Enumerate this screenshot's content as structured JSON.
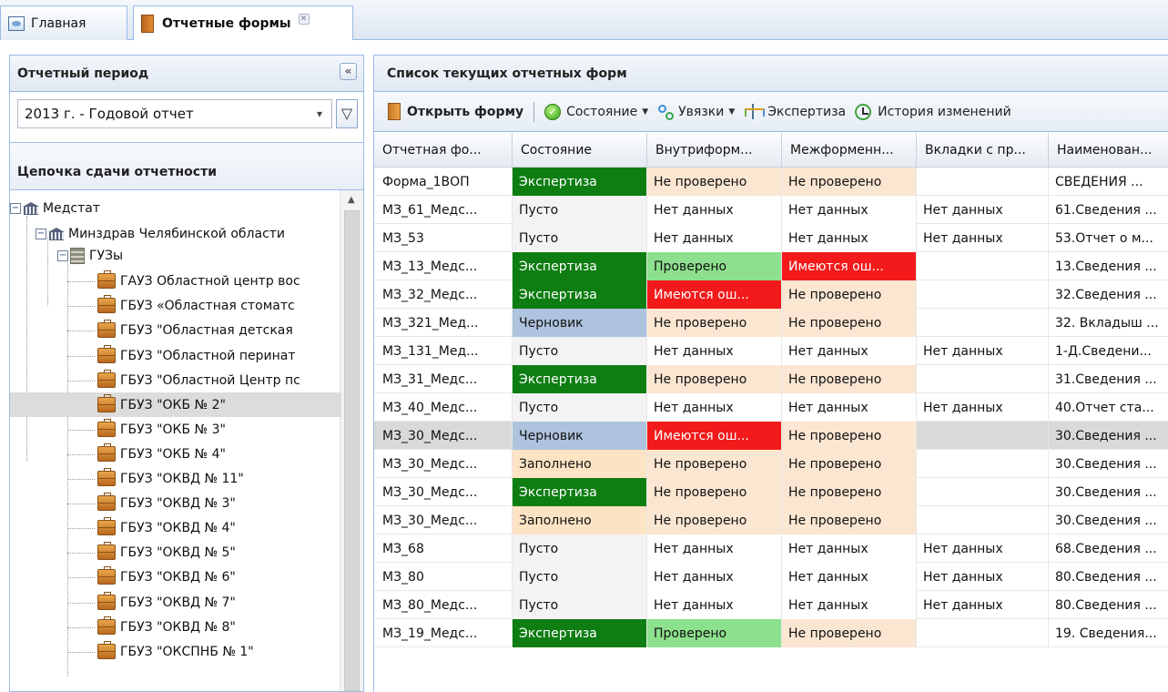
{
  "tabs": [
    {
      "label": "Главная",
      "active": false,
      "icon": "home-tab-icon"
    },
    {
      "label": "Отчетные формы",
      "active": true,
      "icon": "book-icon",
      "closable": true
    }
  ],
  "left_panel": {
    "period_title": "Отчетный период",
    "collapse_glyph": "«",
    "period_value": "2013 г. - Годовой отчет",
    "filter_icon": "filter-icon",
    "chain_title": "Цепочка сдачи отчетности",
    "tree": [
      {
        "level": 0,
        "label": "Медстат",
        "icon": "bank-icon",
        "expander": "⊟"
      },
      {
        "level": 1,
        "label": "Минздрав Челябинской области",
        "icon": "bank-icon",
        "expander": "⊟"
      },
      {
        "level": 2,
        "label": "ГУЗы",
        "icon": "building-icon",
        "expander": "⊟"
      },
      {
        "level": 3,
        "label": "ГАУЗ Областной центр вос",
        "icon": "case-icon"
      },
      {
        "level": 3,
        "label": "ГБУЗ «Областная стоматс",
        "icon": "case-icon"
      },
      {
        "level": 3,
        "label": "ГБУЗ \"Областная детская",
        "icon": "case-icon"
      },
      {
        "level": 3,
        "label": "ГБУЗ \"Областной перинат",
        "icon": "case-icon"
      },
      {
        "level": 3,
        "label": "ГБУЗ \"Областной Центр пс",
        "icon": "case-icon"
      },
      {
        "level": 3,
        "label": "ГБУЗ \"ОКБ № 2\"",
        "icon": "case-icon",
        "selected": true
      },
      {
        "level": 3,
        "label": "ГБУЗ \"ОКБ № 3\"",
        "icon": "case-icon"
      },
      {
        "level": 3,
        "label": "ГБУЗ \"ОКБ № 4\"",
        "icon": "case-icon"
      },
      {
        "level": 3,
        "label": "ГБУЗ \"ОКВД № 11\"",
        "icon": "case-icon"
      },
      {
        "level": 3,
        "label": "ГБУЗ \"ОКВД № 3\"",
        "icon": "case-icon"
      },
      {
        "level": 3,
        "label": "ГБУЗ \"ОКВД № 4\"",
        "icon": "case-icon"
      },
      {
        "level": 3,
        "label": "ГБУЗ \"ОКВД № 5\"",
        "icon": "case-icon"
      },
      {
        "level": 3,
        "label": "ГБУЗ \"ОКВД № 6\"",
        "icon": "case-icon"
      },
      {
        "level": 3,
        "label": "ГБУЗ \"ОКВД № 7\"",
        "icon": "case-icon"
      },
      {
        "level": 3,
        "label": "ГБУЗ \"ОКВД № 8\"",
        "icon": "case-icon"
      },
      {
        "level": 3,
        "label": "ГБУЗ \"ОКСПНБ № 1\"",
        "icon": "case-icon"
      }
    ]
  },
  "right_panel": {
    "title": "Список текущих отчетных форм",
    "toolbar": {
      "open": "Открыть форму",
      "state": "Состояние",
      "links": "Увязки",
      "expertise": "Экспертиза",
      "history": "История изменений"
    },
    "columns": [
      "Отчетная фо...",
      "Состояние",
      "Внутриформ...",
      "Межформенн...",
      "Вкладки с пр...",
      "Наименован..."
    ],
    "rows": [
      {
        "cells": [
          "Форма_1ВОП",
          "Экспертиза",
          "Не проверено",
          "Не проверено",
          "",
          "СВЕДЕНИЯ ..."
        ],
        "styles": [
          "",
          "state-expert",
          "chk-wait",
          "chk-wait",
          "",
          ""
        ]
      },
      {
        "cells": [
          "МЗ_61_Медс...",
          "Пусто",
          "Нет данных",
          "Нет данных",
          "Нет данных",
          "61.Сведения ..."
        ],
        "styles": [
          "",
          "state-empty",
          "chk-none",
          "chk-none",
          "",
          ""
        ]
      },
      {
        "cells": [
          "МЗ_53",
          "Пусто",
          "Нет данных",
          "Нет данных",
          "Нет данных",
          "53.Отчет о м..."
        ],
        "styles": [
          "",
          "state-empty",
          "chk-none",
          "chk-none",
          "",
          ""
        ]
      },
      {
        "cells": [
          "МЗ_13_Медс...",
          "Экспертиза",
          "Проверено",
          "Имеются ош...",
          "",
          "13.Сведения ..."
        ],
        "styles": [
          "",
          "state-expert",
          "chk-green",
          "chk-red",
          "",
          ""
        ]
      },
      {
        "cells": [
          "МЗ_32_Медс...",
          "Экспертиза",
          "Имеются ош...",
          "Не проверено",
          "",
          "32.Сведения ..."
        ],
        "styles": [
          "",
          "state-expert",
          "chk-red",
          "chk-wait",
          "",
          ""
        ]
      },
      {
        "cells": [
          "МЗ_321_Мед...",
          "Черновик",
          "Не проверено",
          "Не проверено",
          "",
          "32. Вкладыш ..."
        ],
        "styles": [
          "",
          "state-draft",
          "chk-wait",
          "chk-wait",
          "",
          ""
        ]
      },
      {
        "cells": [
          "МЗ_131_Мед...",
          "Пусто",
          "Нет данных",
          "Нет данных",
          "Нет данных",
          "1-Д.Сведени..."
        ],
        "styles": [
          "",
          "state-empty",
          "chk-none",
          "chk-none",
          "",
          ""
        ]
      },
      {
        "cells": [
          "МЗ_31_Медс...",
          "Экспертиза",
          "Не проверено",
          "Не проверено",
          "",
          "31.Сведения ..."
        ],
        "styles": [
          "",
          "state-expert",
          "chk-wait",
          "chk-wait",
          "",
          ""
        ]
      },
      {
        "cells": [
          "МЗ_40_Медс...",
          "Пусто",
          "Нет данных",
          "Нет данных",
          "Нет данных",
          "40.Отчет ста..."
        ],
        "styles": [
          "",
          "state-empty",
          "chk-none",
          "chk-none",
          "",
          ""
        ]
      },
      {
        "cells": [
          "МЗ_30_Медс...",
          "Черновик",
          "Имеются ош...",
          "Не проверено",
          "",
          "30.Сведения ..."
        ],
        "styles": [
          "",
          "state-draft",
          "chk-red",
          "chk-wait",
          "",
          ""
        ],
        "selected": true
      },
      {
        "cells": [
          "МЗ_30_Медс...",
          "Заполнено",
          "Не проверено",
          "Не проверено",
          "",
          "30.Сведения ..."
        ],
        "styles": [
          "",
          "state-filled",
          "chk-wait",
          "chk-wait",
          "",
          ""
        ]
      },
      {
        "cells": [
          "МЗ_30_Медс...",
          "Экспертиза",
          "Не проверено",
          "Не проверено",
          "",
          "30.Сведения ..."
        ],
        "styles": [
          "",
          "state-expert",
          "chk-wait",
          "chk-wait",
          "",
          ""
        ]
      },
      {
        "cells": [
          "МЗ_30_Медс...",
          "Заполнено",
          "Не проверено",
          "Не проверено",
          "",
          "30.Сведения ..."
        ],
        "styles": [
          "",
          "state-filled",
          "chk-wait",
          "chk-wait",
          "",
          ""
        ]
      },
      {
        "cells": [
          "МЗ_68",
          "Пусто",
          "Нет данных",
          "Нет данных",
          "Нет данных",
          "68.Сведения ..."
        ],
        "styles": [
          "",
          "state-empty",
          "chk-none",
          "chk-none",
          "",
          ""
        ]
      },
      {
        "cells": [
          "МЗ_80",
          "Пусто",
          "Нет данных",
          "Нет данных",
          "Нет данных",
          "80.Сведения ..."
        ],
        "styles": [
          "",
          "state-empty",
          "chk-none",
          "chk-none",
          "",
          ""
        ]
      },
      {
        "cells": [
          "МЗ_80_Медс...",
          "Пусто",
          "Нет данных",
          "Нет данных",
          "Нет данных",
          "80.Сведения ..."
        ],
        "styles": [
          "",
          "state-empty",
          "chk-none",
          "chk-none",
          "",
          ""
        ]
      },
      {
        "cells": [
          "МЗ_19_Медс...",
          "Экспертиза",
          "Проверено",
          "Не проверено",
          "",
          "19. Сведения..."
        ],
        "styles": [
          "",
          "state-expert",
          "chk-green",
          "chk-wait",
          "",
          ""
        ]
      }
    ]
  },
  "colors": {
    "expertise": "#0e7d12",
    "checked": "#8de08d",
    "errors": "#f21a1a",
    "not_checked": "#fbe6d2",
    "draft": "#aec3de",
    "filled": "#fbe3c4",
    "border": "#99bbe8"
  }
}
